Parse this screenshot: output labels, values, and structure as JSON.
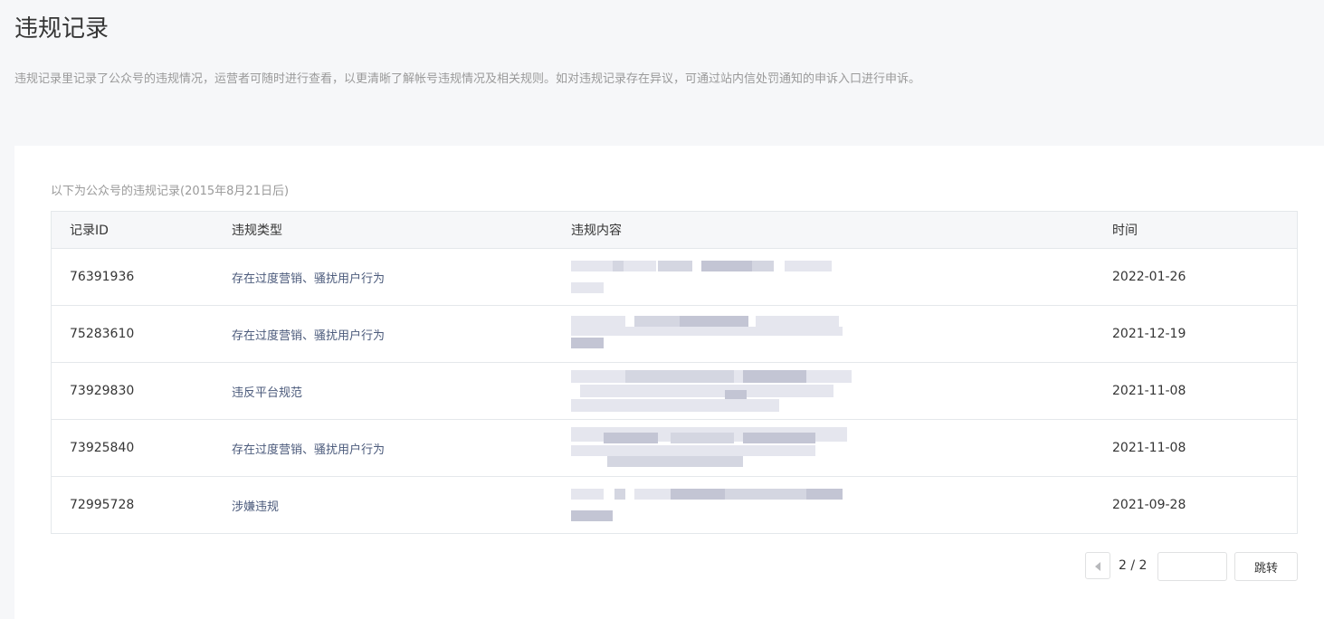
{
  "page": {
    "title": "违规记录",
    "description": "违规记录里记录了公众号的违规情况，运营者可随时进行查看，以更清晰了解帐号违规情况及相关规则。如对违规记录存在异议，可通过站内信处罚通知的申诉入口进行申诉。"
  },
  "table": {
    "caption": "以下为公众号的违规记录(2015年8月21日后)",
    "columns": [
      "记录ID",
      "违规类型",
      "违规内容",
      "时间"
    ],
    "rows": [
      {
        "id": "76391936",
        "type": "存在过度营销、骚扰用户行为",
        "content": "",
        "time": "2022-01-26"
      },
      {
        "id": "75283610",
        "type": "存在过度营销、骚扰用户行为",
        "content": "",
        "time": "2021-12-19"
      },
      {
        "id": "73929830",
        "type": "违反平台规范",
        "content": "",
        "time": "2021-11-08"
      },
      {
        "id": "73925840",
        "type": "存在过度营销、骚扰用户行为",
        "content": "",
        "time": "2021-11-08"
      },
      {
        "id": "72995728",
        "type": "涉嫌违规",
        "content": "",
        "time": "2021-09-28"
      }
    ]
  },
  "pagination": {
    "page_text": "2 / 2",
    "jump_input_value": "",
    "jump_label": "跳转"
  }
}
